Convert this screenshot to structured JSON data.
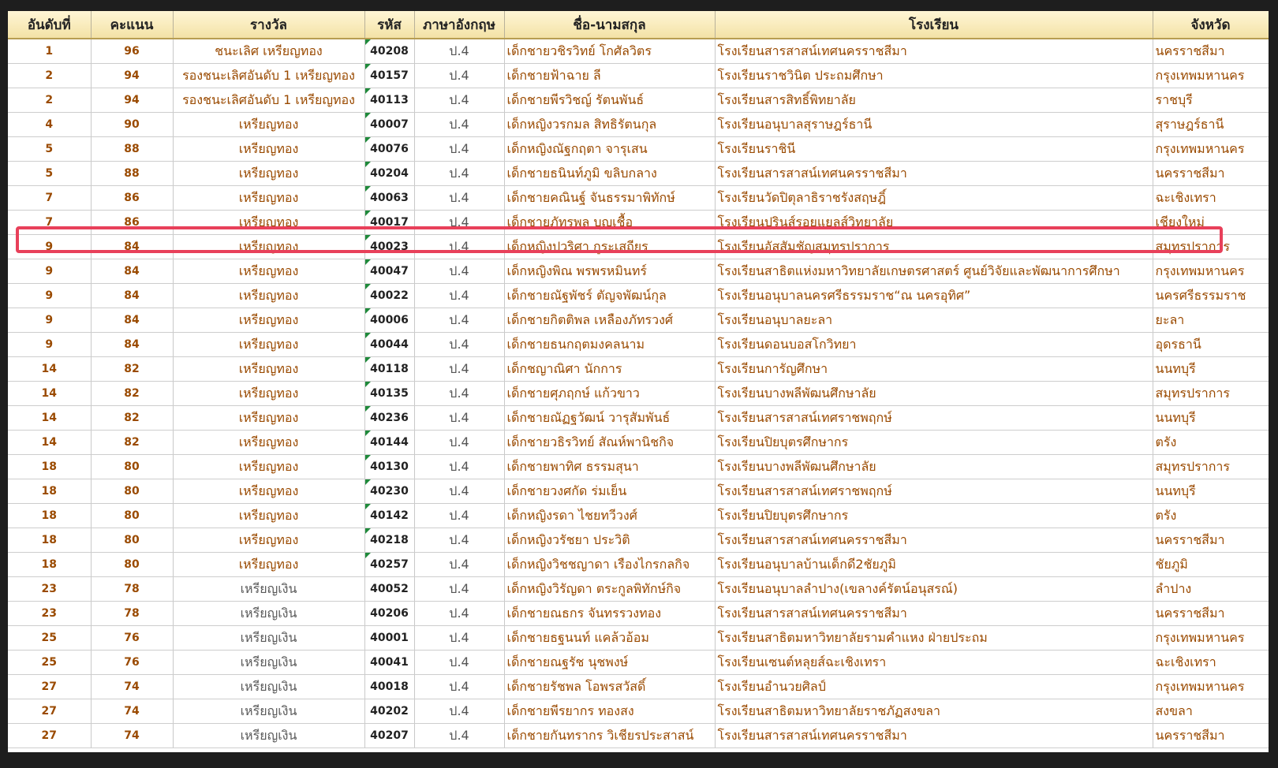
{
  "headers": [
    "อันดับที่",
    "คะแนน",
    "รางวัล",
    "รหัส",
    "ภาษาอังกฤษ",
    "ชื่อ-นามสกุล",
    "โรงเรียน",
    "จังหวัด"
  ],
  "highlight_color": "#e8405a",
  "rows": [
    {
      "rank": "1",
      "score": "96",
      "award": "ชนะเลิศ เหรียญทอง",
      "code": "40208",
      "level": "ป.4",
      "name": "เด็กชายวชิรวิทย์ โกศัลวิตร",
      "school": "โรงเรียนสารสาสน์เทศนครราชสีมา",
      "province": "นครราชสีมา"
    },
    {
      "rank": "2",
      "score": "94",
      "award": "รองชนะเลิศอันดับ 1 เหรียญทอง",
      "code": "40157",
      "level": "ป.4",
      "name": "เด็กชายฟ้าฉาย ลี",
      "school": "โรงเรียนราชวินิต ประถมศึกษา",
      "province": "กรุงเทพมหานคร"
    },
    {
      "rank": "2",
      "score": "94",
      "award": "รองชนะเลิศอันดับ 1 เหรียญทอง",
      "code": "40113",
      "level": "ป.4",
      "name": "เด็กชายพีรวิชญ์ รัตนพันธ์",
      "school": "โรงเรียนสารสิทธิ์พิทยาลัย",
      "province": "ราชบุรี"
    },
    {
      "rank": "4",
      "score": "90",
      "award": "เหรียญทอง",
      "code": "40007",
      "level": "ป.4",
      "name": "เด็กหญิงวรกมล สิทธิรัตนกุล",
      "school": "โรงเรียนอนุบาลสุราษฎร์ธานี",
      "province": "สุราษฎร์ธานี"
    },
    {
      "rank": "5",
      "score": "88",
      "award": "เหรียญทอง",
      "code": "40076",
      "level": "ป.4",
      "name": "เด็กหญิงณัฐกฤตา จารุเสน",
      "school": "โรงเรียนราชินี",
      "province": "กรุงเทพมหานคร"
    },
    {
      "rank": "5",
      "score": "88",
      "award": "เหรียญทอง",
      "code": "40204",
      "level": "ป.4",
      "name": "เด็กชายธนินท์ภูมิ ขลิบกลาง",
      "school": "โรงเรียนสารสาสน์เทศนครราชสีมา",
      "province": "นครราชสีมา"
    },
    {
      "rank": "7",
      "score": "86",
      "award": "เหรียญทอง",
      "code": "40063",
      "level": "ป.4",
      "name": "เด็กชายคณินฐ์ จันธรรมาพิทักษ์",
      "school": "โรงเรียนวัดปิตุลาธิราชรังสฤษฎิ์",
      "province": "ฉะเชิงเทรา"
    },
    {
      "rank": "7",
      "score": "86",
      "award": "เหรียญทอง",
      "code": "40017",
      "level": "ป.4",
      "name": "เด็กชายภัทรพล บุญเชื้อ",
      "school": "โรงเรียนปรินส์รอยแยลส์วิทยาลัย",
      "province": "เชียงใหม่"
    },
    {
      "rank": "9",
      "score": "84",
      "award": "เหรียญทอง",
      "code": "40023",
      "level": "ป.4",
      "name": "เด็กหญิงปวริศา กูระเสถียร",
      "school": "โรงเรียนอัสสัมชัญสมุทรปราการ",
      "province": "สมุทรปราการ"
    },
    {
      "rank": "9",
      "score": "84",
      "award": "เหรียญทอง",
      "code": "40047",
      "level": "ป.4",
      "name": "เด็กหญิงพิณ พรพรหมินทร์",
      "school": "โรงเรียนสาธิตแห่งมหาวิทยาลัยเกษตรศาสตร์ ศูนย์วิจัยและพัฒนาการศึกษา",
      "province": "กรุงเทพมหานคร"
    },
    {
      "rank": "9",
      "score": "84",
      "award": "เหรียญทอง",
      "code": "40022",
      "level": "ป.4",
      "name": "เด็กชายณัฐพัชร์ ตัญจพัฒน์กุล",
      "school": "โรงเรียนอนุบาลนครศรีธรรมราช“ณ นครอุทิศ”",
      "province": "นครศรีธรรมราช"
    },
    {
      "rank": "9",
      "score": "84",
      "award": "เหรียญทอง",
      "code": "40006",
      "level": "ป.4",
      "name": "เด็กชายกิตติพล เหลืองภัทรวงศ์",
      "school": "โรงเรียนอนุบาลยะลา",
      "province": "ยะลา"
    },
    {
      "rank": "9",
      "score": "84",
      "award": "เหรียญทอง",
      "code": "40044",
      "level": "ป.4",
      "name": "เด็กชายธนกฤตมงคลนาม",
      "school": "โรงเรียนดอนบอสโกวิทยา",
      "province": "อุดรธานี"
    },
    {
      "rank": "14",
      "score": "82",
      "award": "เหรียญทอง",
      "code": "40118",
      "level": "ป.4",
      "name": "เด็กชญาณิศา นักการ",
      "school": "โรงเรียนการัญศึกษา",
      "province": "นนทบุรี"
    },
    {
      "rank": "14",
      "score": "82",
      "award": "เหรียญทอง",
      "code": "40135",
      "level": "ป.4",
      "name": "เด็กชายศุภฤกษ์ แก้วขาว",
      "school": "โรงเรียนบางพลีพัฒนศึกษาลัย",
      "province": "สมุทรปราการ"
    },
    {
      "rank": "14",
      "score": "82",
      "award": "เหรียญทอง",
      "code": "40236",
      "level": "ป.4",
      "name": "เด็กชายณัฏฐวัฒน์ วารุสัมพันธ์",
      "school": "โรงเรียนสารสาสน์เทศราชพฤกษ์",
      "province": "นนทบุรี"
    },
    {
      "rank": "14",
      "score": "82",
      "award": "เหรียญทอง",
      "code": "40144",
      "level": "ป.4",
      "name": "เด็กชายวธิรวิทย์ สัณห์พานิชกิจ",
      "school": "โรงเรียนปิยบุตรศึกษากร",
      "province": "ตรัง"
    },
    {
      "rank": "18",
      "score": "80",
      "award": "เหรียญทอง",
      "code": "40130",
      "level": "ป.4",
      "name": "เด็กชายพาทิศ ธรรมสุนา",
      "school": "โรงเรียนบางพลีพัฒนศึกษาลัย",
      "province": "สมุทรปราการ"
    },
    {
      "rank": "18",
      "score": "80",
      "award": "เหรียญทอง",
      "code": "40230",
      "level": "ป.4",
      "name": "เด็กชายวงศกัด ร่มเย็น",
      "school": "โรงเรียนสารสาสน์เทศราชพฤกษ์",
      "province": "นนทบุรี"
    },
    {
      "rank": "18",
      "score": "80",
      "award": "เหรียญทอง",
      "code": "40142",
      "level": "ป.4",
      "name": "เด็กหญิงรดา ไชยทวีวงศ์",
      "school": "โรงเรียนปิยบุตรศึกษากร",
      "province": "ตรัง"
    },
    {
      "rank": "18",
      "score": "80",
      "award": "เหรียญทอง",
      "code": "40218",
      "level": "ป.4",
      "name": "เด็กหญิงวรัชยา ประวิติ",
      "school": "โรงเรียนสารสาสน์เทศนครราชสีมา",
      "province": "นครราชสีมา"
    },
    {
      "rank": "18",
      "score": "80",
      "award": "เหรียญทอง",
      "code": "40257",
      "level": "ป.4",
      "name": "เด็กหญิงวิชชญาดา เรืองไกรกลกิจ",
      "school": "โรงเรียนอนุบาลบ้านเด็กดี2ชัยภูมิ",
      "province": "ชัยภูมิ"
    },
    {
      "rank": "23",
      "score": "78",
      "award": "เหรียญเงิน",
      "code": "40052",
      "level": "ป.4",
      "name": "เด็กหญิงวิรัญดา ตระกูลพิทักษ์กิจ",
      "school": "โรงเรียนอนุบาลลำปาง(เขลางค์รัตน์อนุสรณ์)",
      "province": "ลำปาง"
    },
    {
      "rank": "23",
      "score": "78",
      "award": "เหรียญเงิน",
      "code": "40206",
      "level": "ป.4",
      "name": "เด็กชายณธกร จันทรรวงทอง",
      "school": "โรงเรียนสารสาสน์เทศนครราชสีมา",
      "province": "นครราชสีมา"
    },
    {
      "rank": "25",
      "score": "76",
      "award": "เหรียญเงิน",
      "code": "40001",
      "level": "ป.4",
      "name": "เด็กชายธฐนนท์ แคล้วอ้อม",
      "school": "โรงเรียนสาธิตมหาวิทยาลัยรามคำแหง ฝ่ายประถม",
      "province": "กรุงเทพมหานคร"
    },
    {
      "rank": "25",
      "score": "76",
      "award": "เหรียญเงิน",
      "code": "40041",
      "level": "ป.4",
      "name": "เด็กชายณฐรัช นุชพงษ์",
      "school": "โรงเรียนเซนต์หลุยส์ฉะเชิงเทรา",
      "province": "ฉะเชิงเทรา"
    },
    {
      "rank": "27",
      "score": "74",
      "award": "เหรียญเงิน",
      "code": "40018",
      "level": "ป.4",
      "name": "เด็กชายรัชพล โอพรสวัสดิ์",
      "school": "โรงเรียนอำนวยศิลป์",
      "province": "กรุงเทพมหานคร"
    },
    {
      "rank": "27",
      "score": "74",
      "award": "เหรียญเงิน",
      "code": "40202",
      "level": "ป.4",
      "name": "เด็กชายพีรยากร ทองสง",
      "school": "โรงเรียนสาธิตมหาวิทยาลัยราชภัฏสงขลา",
      "province": "สงขลา"
    },
    {
      "rank": "27",
      "score": "74",
      "award": "เหรียญเงิน",
      "code": "40207",
      "level": "ป.4",
      "name": "เด็กชายกันทรากร วิเชียรประสาสน์",
      "school": "โรงเรียนสารสาสน์เทศนครราชสีมา",
      "province": "นครราชสีมา"
    }
  ]
}
